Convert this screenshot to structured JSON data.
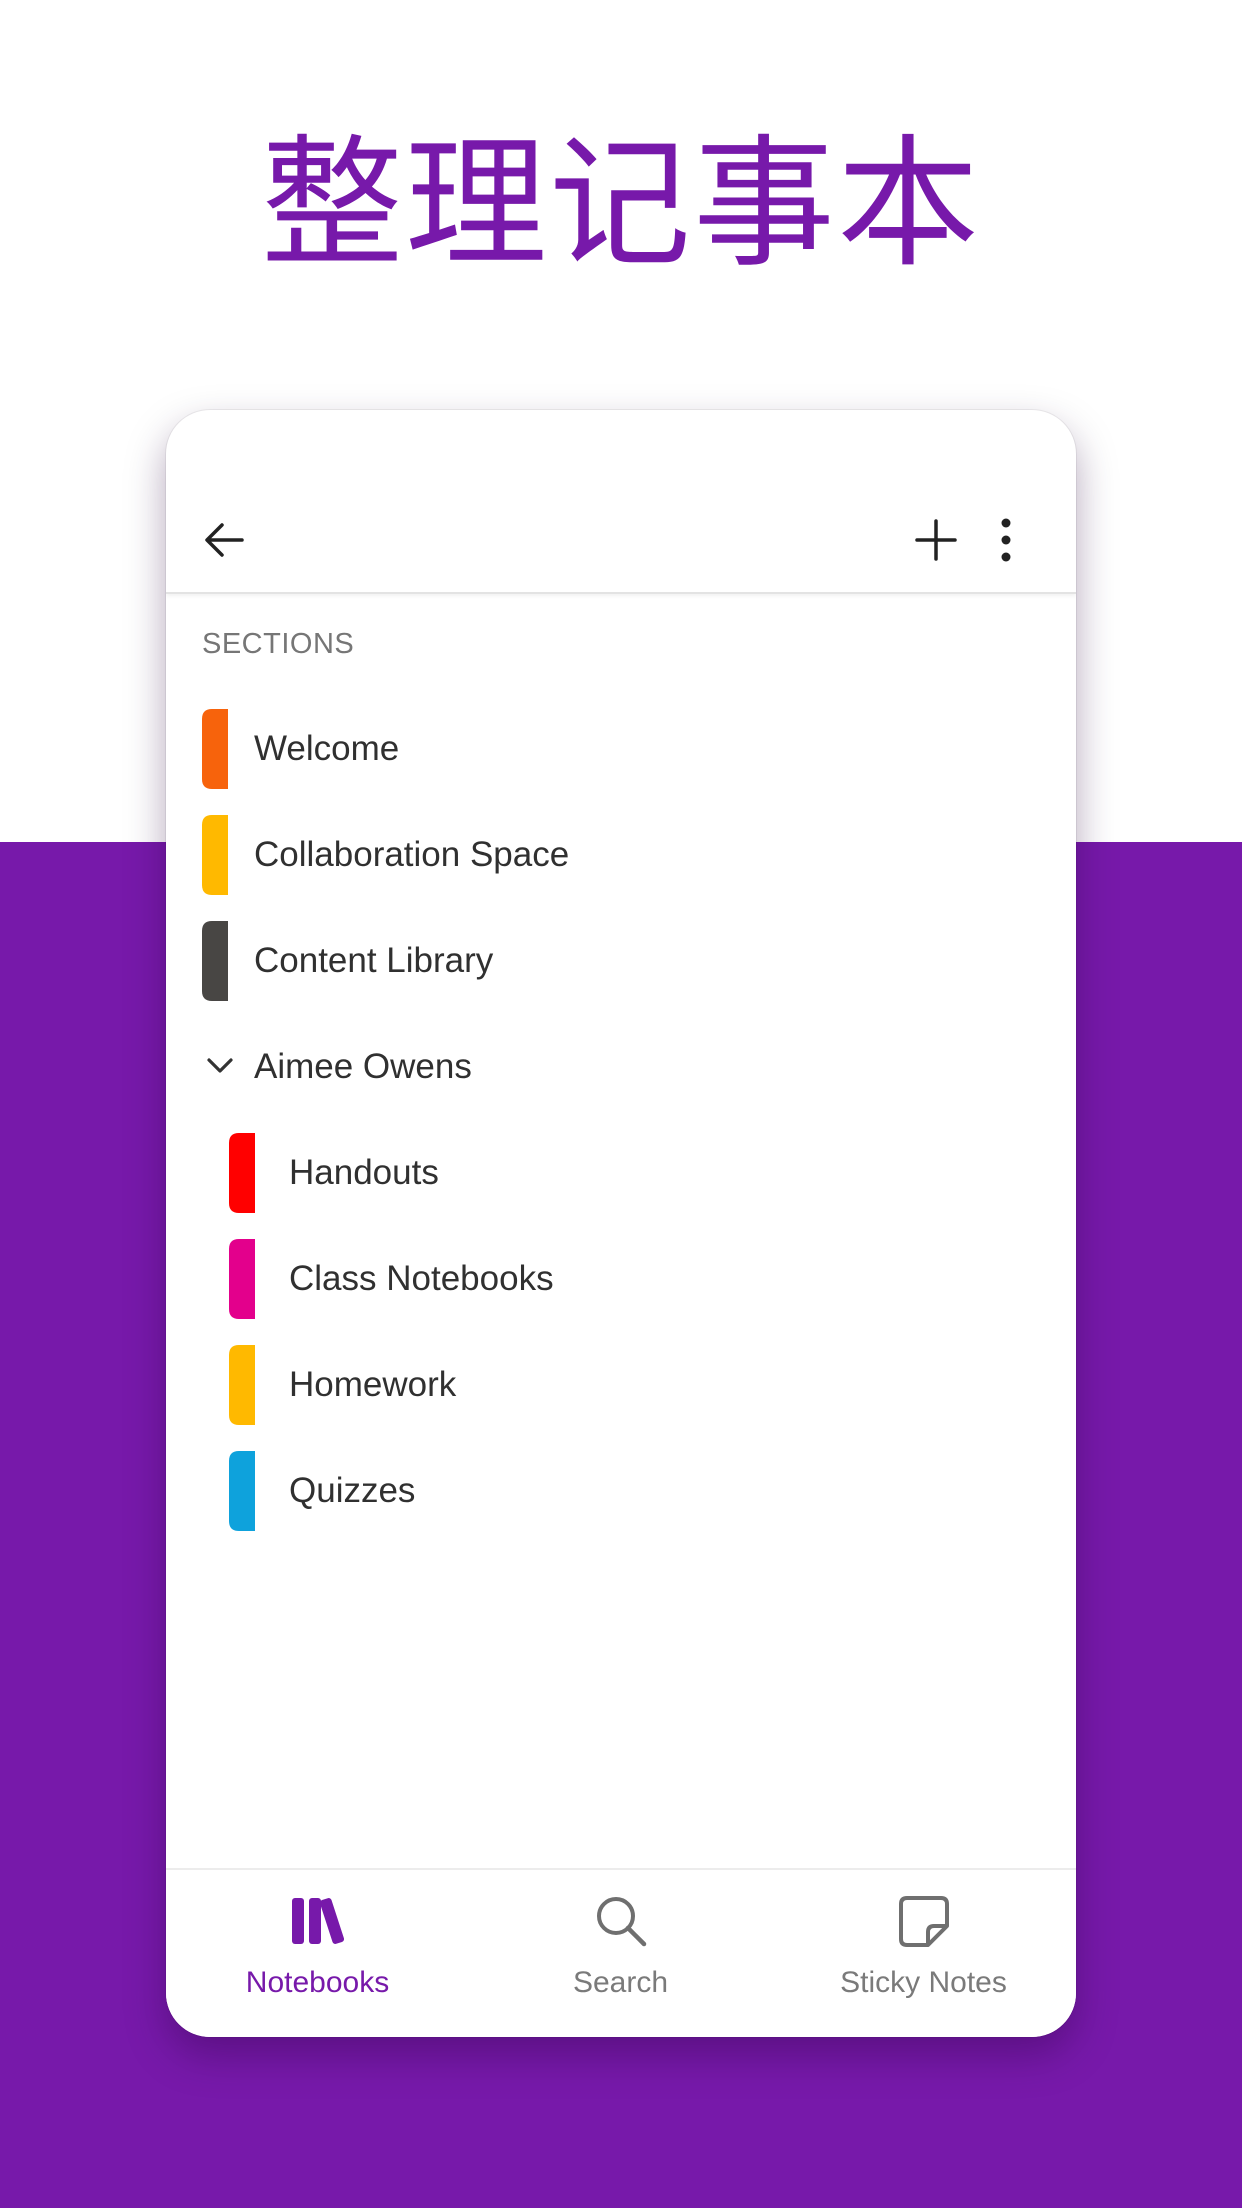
{
  "headline": "整理记事本",
  "colors": {
    "brand": "#7719aa",
    "text": "#303030",
    "muted": "#767676"
  },
  "toolbar": {
    "back_icon": "arrow-left-icon",
    "add_icon": "plus-icon",
    "more_icon": "more-vertical-icon"
  },
  "sections_header": "SECTIONS",
  "sections": [
    {
      "label": "Welcome",
      "color": "#f7630c"
    },
    {
      "label": "Collaboration Space",
      "color": "#ffb900"
    },
    {
      "label": "Content Library",
      "color": "#484644"
    }
  ],
  "group": {
    "label": "Aimee Owens",
    "expanded": true,
    "icon": "chevron-down-icon",
    "sections": [
      {
        "label": "Handouts",
        "color": "#ff0000"
      },
      {
        "label": "Class Notebooks",
        "color": "#e3008c"
      },
      {
        "label": "Homework",
        "color": "#ffb900"
      },
      {
        "label": "Quizzes",
        "color": "#0ea2dc"
      }
    ]
  },
  "bottom_nav": [
    {
      "label": "Notebooks",
      "icon": "notebooks-icon",
      "active": true
    },
    {
      "label": "Search",
      "icon": "search-icon",
      "active": false
    },
    {
      "label": "Sticky Notes",
      "icon": "sticky-note-icon",
      "active": false
    }
  ]
}
